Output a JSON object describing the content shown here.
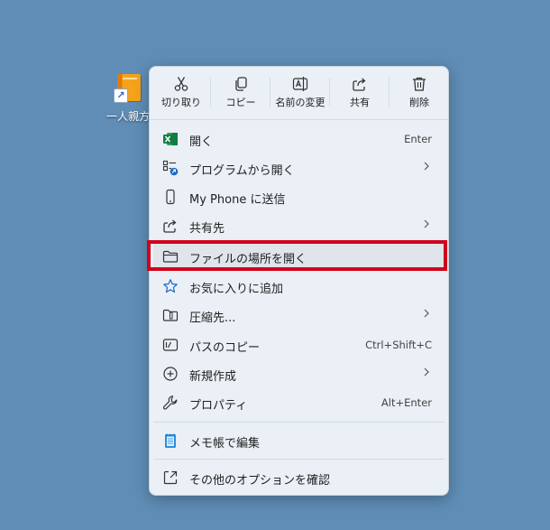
{
  "desktop": {
    "icon_label": "一人親方"
  },
  "toolbar": [
    {
      "label": "切り取り",
      "icon": "scissors-icon"
    },
    {
      "label": "コピー",
      "icon": "copy-icon"
    },
    {
      "label": "名前の変更",
      "icon": "rename-icon"
    },
    {
      "label": "共有",
      "icon": "share-icon"
    },
    {
      "label": "削除",
      "icon": "trash-icon"
    }
  ],
  "items": [
    {
      "label": "開く",
      "shortcut": "Enter",
      "icon": "excel-icon"
    },
    {
      "label": "プログラムから開く",
      "submenu": true,
      "icon": "open-with-icon"
    },
    {
      "label": "My Phone に送信",
      "icon": "phone-icon"
    },
    {
      "label": "共有先",
      "submenu": true,
      "icon": "share-icon"
    },
    {
      "label": "ファイルの場所を開く",
      "icon": "folder-icon",
      "highlighted": true
    },
    {
      "label": "お気に入りに追加",
      "icon": "star-icon"
    },
    {
      "label": "圧縮先...",
      "submenu": true,
      "icon": "zip-folder-icon"
    },
    {
      "label": "パスのコピー",
      "shortcut": "Ctrl+Shift+C",
      "icon": "path-icon"
    },
    {
      "label": "新規作成",
      "submenu": true,
      "icon": "new-icon"
    },
    {
      "label": "プロパティ",
      "shortcut": "Alt+Enter",
      "icon": "wrench-icon"
    },
    {
      "label": "メモ帳で編集",
      "icon": "notepad-icon"
    },
    {
      "label": "その他のオプションを確認",
      "icon": "more-options-icon"
    }
  ],
  "colors": {
    "desktop_bg": "#5f8db5",
    "menu_bg": "#eaf0f5",
    "highlight_box": "#d0021b",
    "accent": "#1e67c8"
  }
}
